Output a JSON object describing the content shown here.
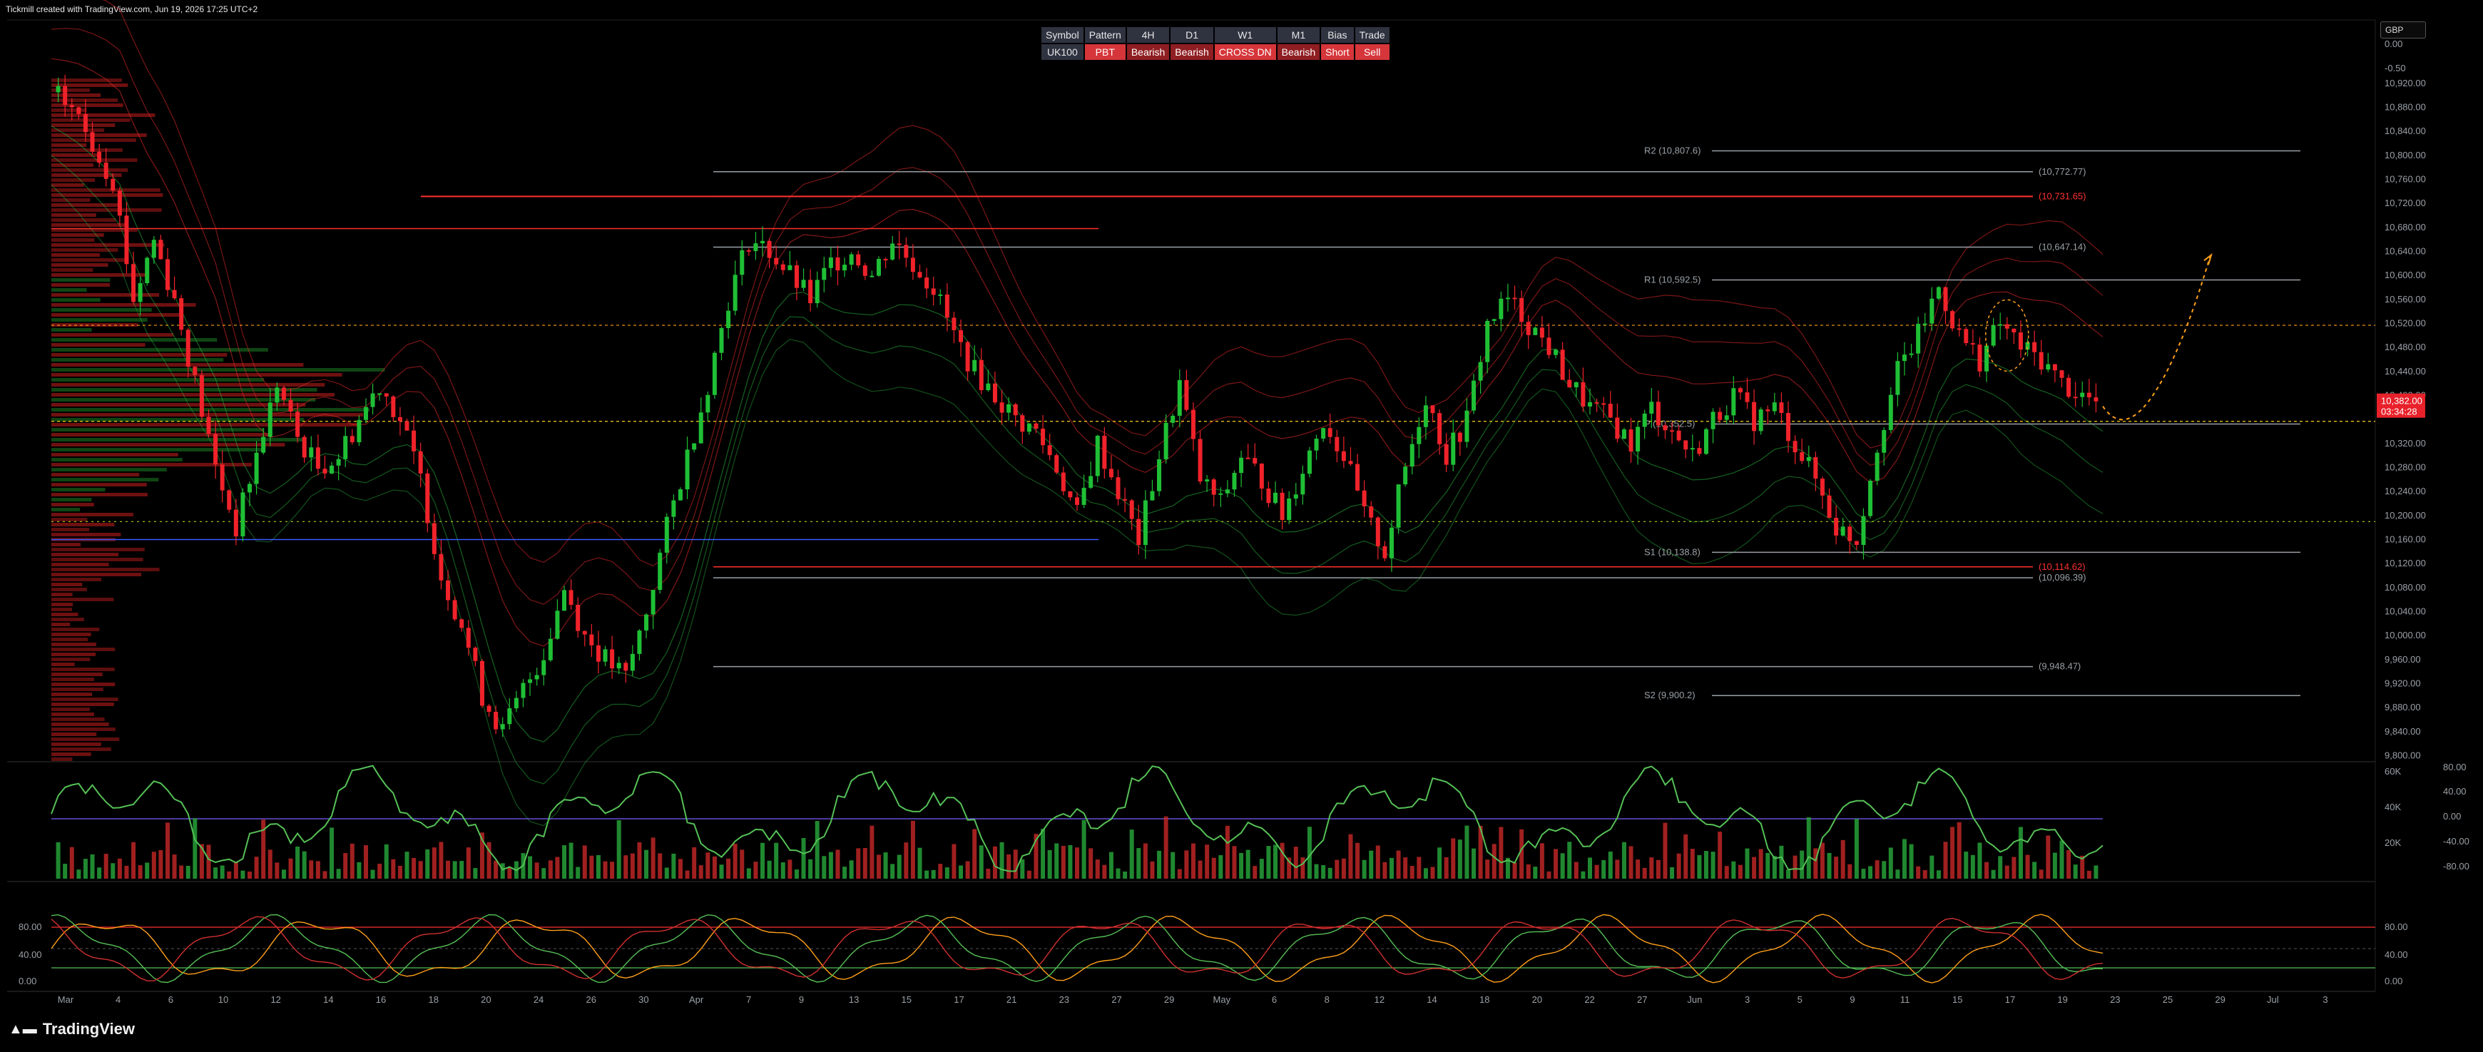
{
  "caption": "Tickmill created with TradingView.com, Jun 19, 2026 17:25 UTC+2",
  "brand": "TradingView",
  "currency": "GBP",
  "table": {
    "headers": [
      "Symbol",
      "Pattern",
      "4H",
      "D1",
      "W1",
      "M1",
      "Bias",
      "Trade"
    ],
    "row": [
      "UK100",
      "PBT",
      "Bearish",
      "Bearish",
      "CROSS DN",
      "Bearish",
      "Short",
      "Sell"
    ]
  },
  "colors": {
    "up": "#1fbf35",
    "down": "#f0222a",
    "pivot": "#9aa0a6",
    "accent_orange": "#ff9f1a",
    "price_label_bg": "#e8212a"
  },
  "chart_data": {
    "type": "candlestick",
    "symbol": "UK100",
    "price_axis": {
      "ticks": [
        "0.00",
        "-0.50",
        "10,920.00",
        "10,880.00",
        "10,840.00",
        "10,800.00",
        "10,760.00",
        "10,720.00",
        "10,680.00",
        "10,640.00",
        "10,600.00",
        "10,560.00",
        "10,520.00",
        "10,480.00",
        "10,440.00",
        "10,400.00",
        "10,320.00",
        "10,280.00",
        "10,240.00",
        "10,200.00",
        "10,160.00",
        "10,120.00",
        "10,080.00",
        "10,040.00",
        "10,000.00",
        "9,960.00",
        "9,920.00",
        "9,880.00",
        "9,840.00",
        "9,800.00"
      ],
      "range": [
        9790,
        10940
      ]
    },
    "current_price": {
      "value": "10,382.00",
      "timer": "03:34:28"
    },
    "time_axis": {
      "labels": [
        "Mar",
        "4",
        "6",
        "10",
        "12",
        "14",
        "16",
        "18",
        "20",
        "24",
        "26",
        "30",
        "Apr",
        "7",
        "9",
        "13",
        "15",
        "17",
        "21",
        "23",
        "27",
        "29",
        "May",
        "6",
        "8",
        "12",
        "14",
        "18",
        "20",
        "22",
        "27",
        "Jun",
        "3",
        "5",
        "9",
        "11",
        "15",
        "17",
        "19",
        "23",
        "25",
        "29",
        "Jul",
        "3"
      ]
    },
    "levels": [
      {
        "label": "R2 (10,807.6)",
        "value": 10807.6,
        "color": "#9aa0a6"
      },
      {
        "label": "(10,772.77)",
        "value": 10772.77,
        "color": "#9aa0a6"
      },
      {
        "label": "(10,731.65)",
        "value": 10731.65,
        "color": "#ff3030"
      },
      {
        "label": "(10,647.14)",
        "value": 10647.14,
        "color": "#9aa0a6"
      },
      {
        "label": "R1 (10,592.5)",
        "value": 10592.5,
        "color": "#9aa0a6"
      },
      {
        "label": "P (10,352.5)",
        "value": 10352.5,
        "color": "#9aa0a6"
      },
      {
        "label": "S1 (10,138.8)",
        "value": 10138.8,
        "color": "#9aa0a6"
      },
      {
        "label": "(10,114.62)",
        "value": 10114.62,
        "color": "#ff3030"
      },
      {
        "label": "(10,096.39)",
        "value": 10096.39,
        "color": "#9aa0a6"
      },
      {
        "label": "(9,948.47)",
        "value": 9948.47,
        "color": "#9aa0a6"
      },
      {
        "label": "S2 (9,900.2)",
        "value": 9900.2,
        "color": "#9aa0a6"
      }
    ],
    "path": [
      [
        0,
        10905
      ],
      [
        3,
        10880
      ],
      [
        6,
        10820
      ],
      [
        9,
        10760
      ],
      [
        12,
        10560
      ],
      [
        15,
        10660
      ],
      [
        18,
        10560
      ],
      [
        21,
        10420
      ],
      [
        24,
        10280
      ],
      [
        27,
        10180
      ],
      [
        30,
        10300
      ],
      [
        33,
        10420
      ],
      [
        36,
        10330
      ],
      [
        39,
        10280
      ],
      [
        42,
        10300
      ],
      [
        45,
        10360
      ],
      [
        48,
        10420
      ],
      [
        51,
        10360
      ],
      [
        54,
        10260
      ],
      [
        57,
        10100
      ],
      [
        60,
        10020
      ],
      [
        63,
        9900
      ],
      [
        66,
        9840
      ],
      [
        69,
        9910
      ],
      [
        72,
        9970
      ],
      [
        75,
        10080
      ],
      [
        78,
        10000
      ],
      [
        81,
        9960
      ],
      [
        84,
        9930
      ],
      [
        87,
        10040
      ],
      [
        90,
        10180
      ],
      [
        93,
        10300
      ],
      [
        96,
        10420
      ],
      [
        99,
        10560
      ],
      [
        102,
        10660
      ],
      [
        105,
        10640
      ],
      [
        108,
        10600
      ],
      [
        111,
        10560
      ],
      [
        114,
        10620
      ],
      [
        117,
        10640
      ],
      [
        120,
        10600
      ],
      [
        123,
        10660
      ],
      [
        126,
        10620
      ],
      [
        129,
        10580
      ],
      [
        132,
        10500
      ],
      [
        135,
        10440
      ],
      [
        138,
        10400
      ],
      [
        141,
        10360
      ],
      [
        144,
        10340
      ],
      [
        147,
        10280
      ],
      [
        150,
        10200
      ],
      [
        153,
        10320
      ],
      [
        156,
        10240
      ],
      [
        159,
        10160
      ],
      [
        162,
        10300
      ],
      [
        165,
        10420
      ],
      [
        168,
        10260
      ],
      [
        171,
        10220
      ],
      [
        174,
        10300
      ],
      [
        177,
        10260
      ],
      [
        180,
        10200
      ],
      [
        183,
        10280
      ],
      [
        186,
        10360
      ],
      [
        189,
        10300
      ],
      [
        192,
        10200
      ],
      [
        195,
        10140
      ],
      [
        198,
        10280
      ],
      [
        201,
        10400
      ],
      [
        204,
        10300
      ],
      [
        207,
        10360
      ],
      [
        210,
        10520
      ],
      [
        213,
        10560
      ],
      [
        216,
        10520
      ],
      [
        219,
        10480
      ],
      [
        222,
        10420
      ],
      [
        225,
        10380
      ],
      [
        228,
        10360
      ],
      [
        231,
        10320
      ],
      [
        234,
        10380
      ],
      [
        237,
        10340
      ],
      [
        240,
        10300
      ],
      [
        243,
        10360
      ],
      [
        246,
        10400
      ],
      [
        249,
        10360
      ],
      [
        252,
        10380
      ],
      [
        255,
        10320
      ],
      [
        258,
        10260
      ],
      [
        261,
        10180
      ],
      [
        264,
        10160
      ],
      [
        267,
        10320
      ],
      [
        270,
        10440
      ],
      [
        273,
        10500
      ],
      [
        276,
        10580
      ],
      [
        279,
        10500
      ],
      [
        282,
        10460
      ],
      [
        285,
        10520
      ],
      [
        288,
        10480
      ],
      [
        291,
        10460
      ],
      [
        294,
        10420
      ],
      [
        297,
        10400
      ],
      [
        300,
        10382
      ]
    ],
    "projection": "curve down to ~10,350 then up to ~10,630",
    "oscillator_1": {
      "axis": [
        "80.00",
        "40.00",
        "0.00",
        "-40.00",
        "-80.00"
      ],
      "volume_axis": [
        "60K",
        "40K",
        "20K"
      ]
    },
    "oscillator_2": {
      "axis": [
        "80.00",
        "40.00",
        "0.00"
      ]
    }
  }
}
